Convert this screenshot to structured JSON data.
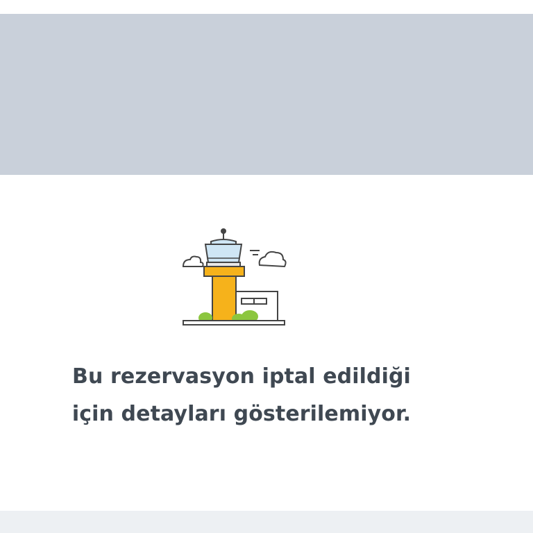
{
  "header": {
    "background_color": "#c9d0da"
  },
  "illustration": {
    "icon": "airport-control-tower-icon",
    "tower_color": "#f6b21b",
    "glass_color": "#cfe6f5",
    "bush_color": "#8cc63f"
  },
  "message": {
    "line1": "Bu rezervasyon iptal edildiği",
    "line2": "için detayları gösterilemiyor."
  },
  "footer": {
    "background_color": "#edf0f3"
  }
}
